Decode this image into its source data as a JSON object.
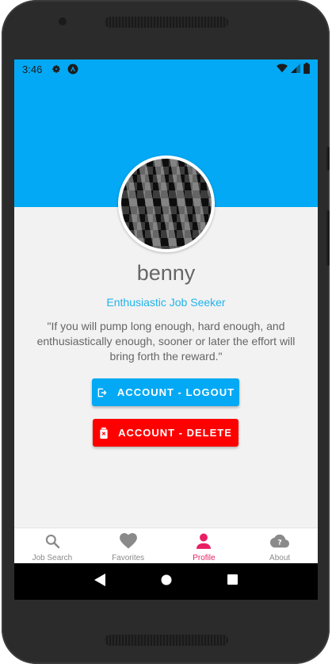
{
  "status_bar": {
    "time": "3:46",
    "icons": [
      "gear-icon",
      "app-logo-icon"
    ],
    "right_icons": [
      "wifi-icon",
      "signal-icon",
      "battery-icon"
    ]
  },
  "profile": {
    "username": "benny",
    "title": "Enthusiastic Job Seeker",
    "quote": "\"If you will pump long enough, hard enough, and enthusiastically enough, sooner or later the effort will bring forth the reward.\""
  },
  "buttons": {
    "logout_label": "ACCOUNT - LOGOUT",
    "delete_label": "ACCOUNT - DELETE"
  },
  "bottom_nav": {
    "items": [
      {
        "label": "Job Search",
        "icon": "search-icon"
      },
      {
        "label": "Favorites",
        "icon": "heart-icon"
      },
      {
        "label": "Profile",
        "icon": "person-icon",
        "active": true
      },
      {
        "label": "About",
        "icon": "cloud-help-icon"
      }
    ]
  },
  "colors": {
    "header": "#03a9f4",
    "accent_text": "#22b3ea",
    "delete": "#ff0000",
    "active_tab": "#e91e63"
  }
}
